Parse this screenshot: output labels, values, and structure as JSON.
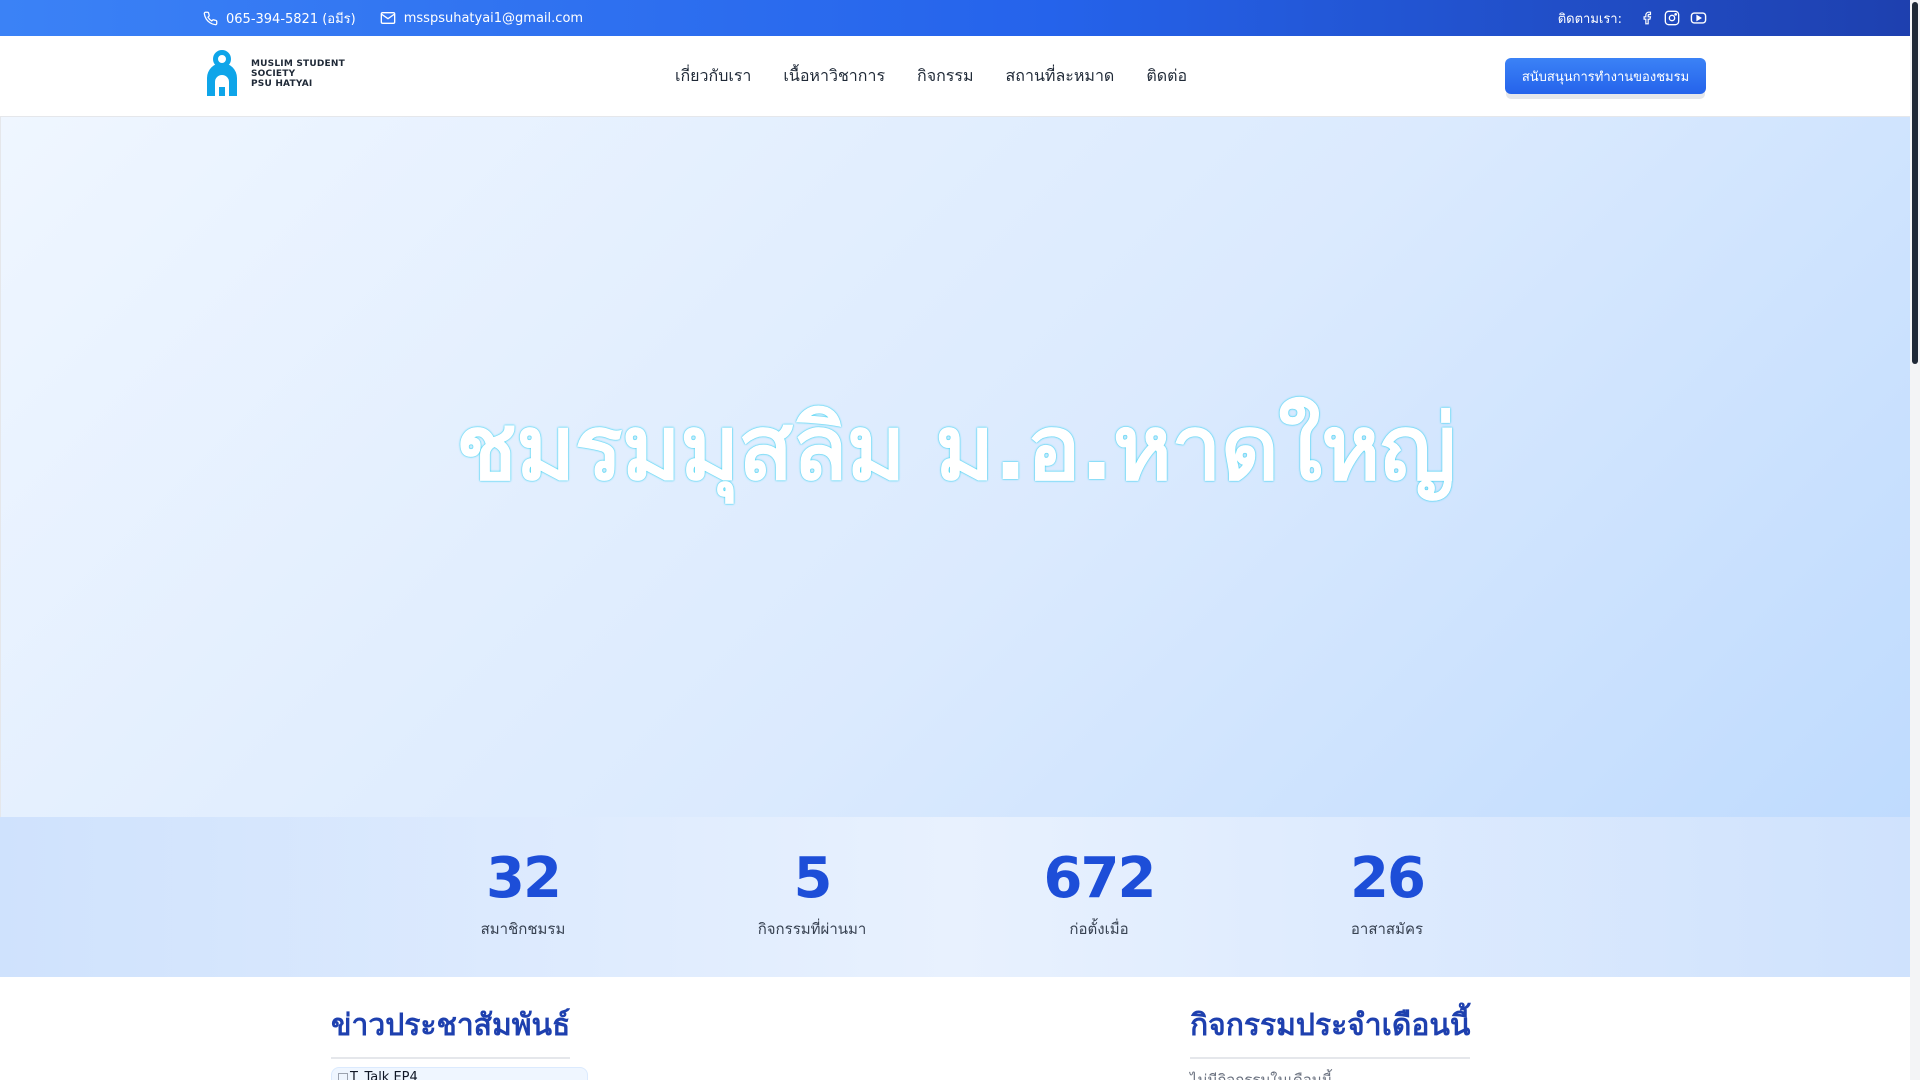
{
  "topbar": {
    "phone": "065-394-5821 (อมีร)",
    "email": "msspsuhatyai1@gmail.com",
    "follow_label": "ติดตามเรา:",
    "social": [
      "facebook-icon",
      "instagram-icon",
      "youtube-icon"
    ]
  },
  "header": {
    "logo": {
      "line1": "MUSLIM STUDENT",
      "line2": "SOCIETY",
      "line3": "PSU HATYAI"
    },
    "nav": [
      "เกี่ยวกับเรา",
      "เนื้อหาวิชาการ",
      "กิจกรรม",
      "สถานที่ละหมาด",
      "ติดต่อ"
    ],
    "cta": "สนับสนุนการทำงานของชมรม"
  },
  "hero": {
    "title": "ชมรมมุสลิม ม.อ.หาดใหญ่"
  },
  "stats": [
    {
      "value": "32",
      "label": "สมาชิกชมรม"
    },
    {
      "value": "5",
      "label": "กิจกรรมที่ผ่านมา"
    },
    {
      "value": "672",
      "label": "ก่อตั้งเมื่อ"
    },
    {
      "value": "26",
      "label": "อาสาสมัคร"
    }
  ],
  "news": {
    "title": "ข่าวประชาสัมพันธ์",
    "first_item_alt": "T_Talk EP4"
  },
  "activities": {
    "title": "กิจกรรมประจำเดือนนี้",
    "empty": "ไม่มีกิจกรรมในเดือนนี้"
  },
  "colors": {
    "primary": "#2563eb",
    "dark_blue": "#1d4ed8",
    "title_blue": "#1e40af",
    "logo_blue": "#0ea5e9"
  }
}
